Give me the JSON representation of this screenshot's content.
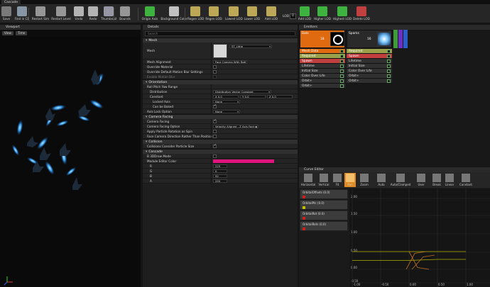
{
  "window": {
    "tab": "Cascade"
  },
  "toolbar": {
    "buttons": [
      {
        "label": "Save",
        "icon": "save-icon",
        "color": "#8a8a8a"
      },
      {
        "label": "Find in CB",
        "icon": "find-icon",
        "color": "#9ab"
      },
      {
        "label": "Restart Sim",
        "icon": "restart-sim-icon",
        "color": "#aaa"
      },
      {
        "label": "Restart Level",
        "icon": "restart-level-icon",
        "color": "#aaa"
      },
      {
        "label": "Undo",
        "icon": "undo-icon",
        "color": "#ccc"
      },
      {
        "label": "Redo",
        "icon": "redo-icon",
        "color": "#ccc"
      },
      {
        "label": "Thumbnail",
        "icon": "thumbnail-icon",
        "color": "#aab"
      },
      {
        "label": "Bounds",
        "icon": "bounds-icon",
        "color": "#aaa"
      },
      {
        "label": "Origin Axis",
        "icon": "origin-axis-icon",
        "color": "#4c4"
      },
      {
        "label": "Background Color",
        "icon": "background-color-icon",
        "color": "#ddd"
      },
      {
        "label": "Regen LOD",
        "icon": "regen-lod-icon",
        "color": "#d8c060"
      },
      {
        "label": "Regen LOD",
        "icon": "regen-lod-2-icon",
        "color": "#d8c060"
      },
      {
        "label": "Lowest LOD",
        "icon": "lowest-lod-icon",
        "color": "#d8c060"
      },
      {
        "label": "Lower LOD",
        "icon": "lower-lod-icon",
        "color": "#d8c060"
      },
      {
        "label": "Add LOD",
        "icon": "add-lod-icon",
        "color": "#d8c060"
      },
      {
        "label": "Add LOD",
        "icon": "add-lod-2-icon",
        "color": "#4c4"
      },
      {
        "label": "Higher LOD",
        "icon": "higher-lod-icon",
        "color": "#4c4"
      },
      {
        "label": "Highest LOD",
        "icon": "highest-lod-icon",
        "color": "#4c4"
      },
      {
        "label": "Delete LOD",
        "icon": "delete-lod-icon",
        "color": "#d44"
      }
    ],
    "lod_label": "LOD",
    "lod_value": "0"
  },
  "viewport": {
    "tab": "Viewport",
    "view_btn": "View",
    "time_btn": "Time"
  },
  "details": {
    "tab": "Details",
    "search_placeholder": "Search",
    "sections": {
      "mesh": "Mesh",
      "orientation": "Orientation",
      "camera_facing": "Camera Facing",
      "collision": "Collision",
      "cascade": "Cascade"
    },
    "mesh": {
      "mesh_label": "Mesh",
      "mesh_asset": "ST_Little",
      "alignment_label": "Mesh Alignment",
      "alignment_value": "Face Camera With Roll",
      "override_material": "Override Material",
      "override_motion_blur": "Override Default Motion Blur Settings",
      "enable_motion_blur": "Enable Motion Blur"
    },
    "orientation": {
      "roll_pitch_yaw": "Roll Pitch Yaw Range",
      "distribution": "Distribution",
      "distribution_value": "Distribution Vector Constant",
      "constant": "Constant",
      "x": "0.0",
      "y": "0.0",
      "z": "0.0",
      "locked_axis": "Locked Axis",
      "locked_axis_value": "None",
      "can_be_baked": "Can be Baked",
      "axis_lock_option": "Axis Lock Option",
      "axis_lock_value": "None"
    },
    "camera": {
      "camera_facing": "Camera Facing",
      "facing_option": "Camera Facing Option",
      "facing_option_value": "Velocity Aligned - Z Axis Facing",
      "apply_rotation": "Apply Particle Rotation as Spin",
      "face_direction": "Face Camera Direction Rather Than Position"
    },
    "collision": {
      "collisions_partial": "Collisions Consider Particle Size"
    },
    "cascade": {
      "three_d_draw": "B 3DDraw Mode",
      "module_color": "Module Editor Color",
      "module_color_hex": "#e0147c",
      "r_label": "R",
      "r": "225",
      "g_label": "G",
      "g": "0",
      "b_label": "B",
      "b": "92",
      "a_label": "A",
      "a": "255"
    }
  },
  "emitters": {
    "tab": "Emitters",
    "col1": {
      "name": "Bats",
      "count": "18",
      "modules": [
        "Mesh Data",
        "Required",
        "Spawn",
        "Lifetime",
        "Initial Size",
        "Color Over Life",
        "Orbit+",
        "Orbit+"
      ]
    },
    "col2": {
      "name": "Sparks",
      "count": "16",
      "modules": [
        "Required",
        "Spawn",
        "Lifetime",
        "Initial Size",
        "Color Over Life",
        "Orbit+",
        "Orbit+"
      ]
    }
  },
  "curve_editor": {
    "tab": "Curve Editor",
    "tools": [
      "Horizontal",
      "Vertical",
      "Fit",
      "Pan",
      "Zoom",
      "Auto",
      "Auto/Clamped",
      "User",
      "Break",
      "Linear",
      "Constant"
    ],
    "curves": [
      {
        "label": "OrbitalOffsets (0.0)",
        "color": "#cc2020"
      },
      {
        "label": "OrbitalPtc (0.0)",
        "color": "#c0c000"
      },
      {
        "label": "OrbitalRot (0.0)",
        "color": "#cc2020"
      },
      {
        "label": "OrbitalRots (0.0)",
        "color": "#cc2020"
      }
    ],
    "y_ticks": [
      "2.00",
      "1.50",
      "1.00",
      "0.50",
      "0.00",
      "-0.50"
    ],
    "x_ticks": [
      "-1.00",
      "-0.50",
      "0.00",
      "0.50",
      "1.00"
    ]
  }
}
